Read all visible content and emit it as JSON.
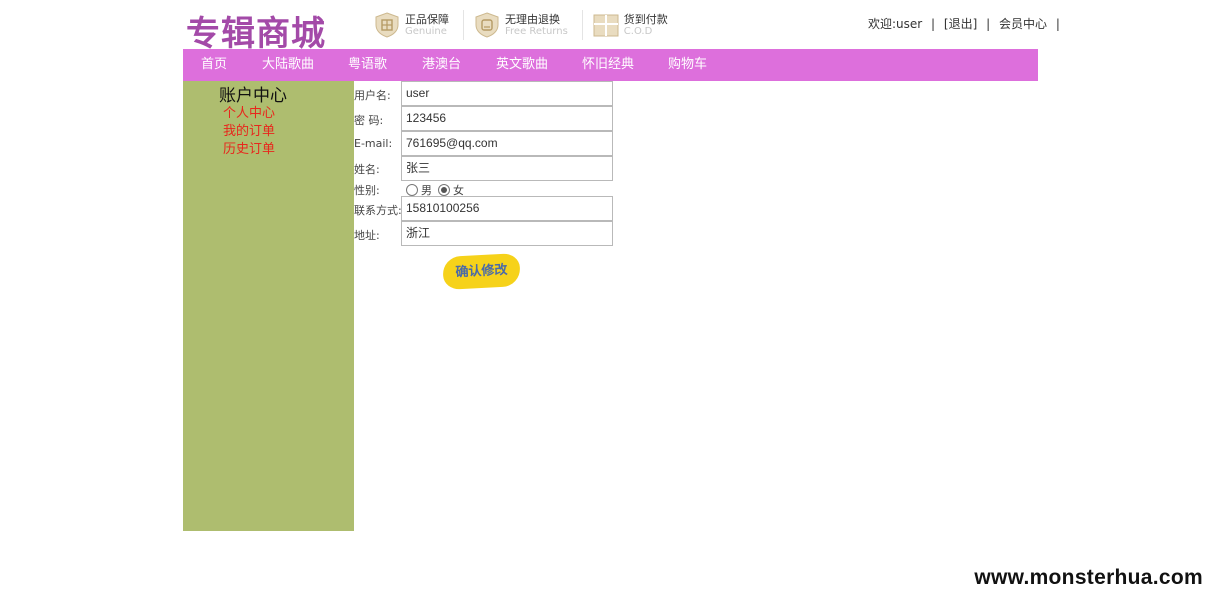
{
  "header": {
    "logo_text": "专辑商城",
    "logo_color": "#a34aa8",
    "guarantees": [
      {
        "title": "正品保障",
        "subtitle": "Genuine",
        "icon": "shield-yin-icon"
      },
      {
        "title": "无理由退换",
        "subtitle": "Free Returns",
        "icon": "shield-return-icon"
      },
      {
        "title": "货到付款",
        "subtitle": "C.O.D",
        "icon": "package-icon"
      }
    ],
    "welcome": "欢迎:user",
    "logout": "[退出]",
    "member_center": "会员中心",
    "separator": "|"
  },
  "nav": {
    "items": [
      "首页",
      "大陆歌曲",
      "粤语歌",
      "港澳台",
      "英文歌曲",
      "怀旧经典",
      "购物车"
    ],
    "bg_color": "#dd6fdc"
  },
  "sidebar": {
    "title": "账户中心",
    "links": [
      "个人中心",
      "我的订单",
      "历史订单"
    ],
    "bg_color": "#aebd6f",
    "link_color": "#e8261c"
  },
  "form": {
    "fields": {
      "username": {
        "label": "用户名:",
        "value": "user"
      },
      "password": {
        "label": "密  码:",
        "value": "123456"
      },
      "email": {
        "label": "E-mail:",
        "value": "761695@qq.com"
      },
      "name": {
        "label": "姓名:",
        "value": "张三"
      },
      "gender": {
        "label": "性别:",
        "options": [
          "男",
          "女"
        ],
        "selected": "女"
      },
      "phone": {
        "label": "联系方式:",
        "value": "15810100256"
      },
      "address": {
        "label": "地址:",
        "value": "浙江"
      }
    },
    "submit_label": "确认修改",
    "submit_color": "#f6d21a"
  },
  "watermark": "www.monsterhua.com"
}
